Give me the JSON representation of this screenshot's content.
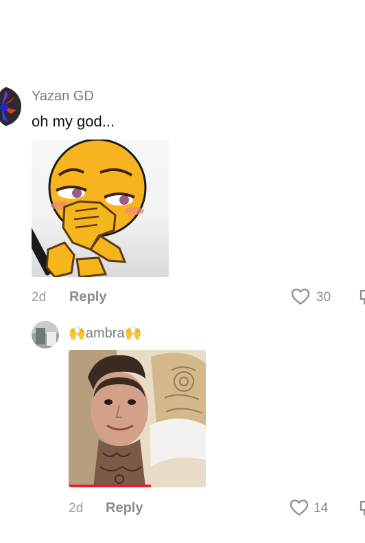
{
  "comments": [
    {
      "username": "Yazan GD",
      "text": "oh my god...",
      "media": "sticker-blushing-emoji",
      "age": "2d",
      "reply_label": "Reply",
      "like_count": "30"
    },
    {
      "username": "🙌ambra🙌",
      "media": "photo-selfie",
      "age": "2d",
      "reply_label": "Reply",
      "like_count": "14"
    }
  ],
  "icons": {
    "like": "heart-outline-icon",
    "dislike": "thumbs-down-icon"
  }
}
